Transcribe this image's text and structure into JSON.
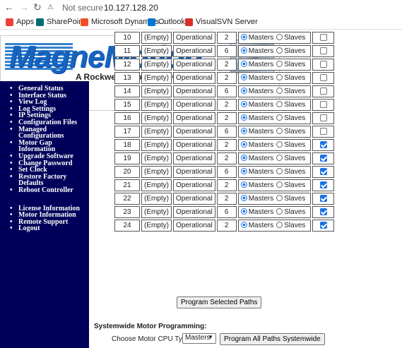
{
  "browser": {
    "security_label": "Not secure",
    "url": "10.127.128.20",
    "bookmarks": [
      {
        "label": "Apps",
        "icon": "apps-grid-icon",
        "color": "#ea4335"
      },
      {
        "label": "SharePoint",
        "icon": "sharepoint-icon",
        "color": "#036c70"
      },
      {
        "label": "Microsoft Dynamics...",
        "icon": "dynamics-icon",
        "color": "#f25022"
      },
      {
        "label": "Outlook",
        "icon": "outlook-icon",
        "color": "#0078d4"
      },
      {
        "label": "VisualSVN Server",
        "icon": "visualsvn-icon",
        "color": "#d93025"
      }
    ]
  },
  "banner": {
    "brand": "MagneMotion",
    "tagline": "A Rockwell Automation Company"
  },
  "sidebar": {
    "group1": [
      "General Status",
      "Interface Status",
      "View Log",
      "Log Settings",
      "IP Settings",
      "Configuration Files",
      "Managed Configurations",
      "Motor Gap Information",
      "Upgrade Software",
      "Change Password",
      "Set Clock",
      "Restore Factory Defaults",
      "Reboot Controller"
    ],
    "group2": [
      "License Information",
      "Motor Information",
      "Remote Support",
      "Logout"
    ]
  },
  "table": {
    "radio_labels": [
      "Masters",
      "Slaves"
    ],
    "rows": [
      {
        "idx": "10",
        "name": "(Empty)",
        "status": "Operational",
        "count": "2",
        "mode": "Masters",
        "checked": false
      },
      {
        "idx": "11",
        "name": "(Empty)",
        "status": "Operational",
        "count": "6",
        "mode": "Masters",
        "checked": false
      },
      {
        "idx": "12",
        "name": "(Empty)",
        "status": "Operational",
        "count": "2",
        "mode": "Masters",
        "checked": false
      },
      {
        "idx": "13",
        "name": "(Empty)",
        "status": "Operational",
        "count": "2",
        "mode": "Masters",
        "checked": false
      },
      {
        "idx": "14",
        "name": "(Empty)",
        "status": "Operational",
        "count": "6",
        "mode": "Masters",
        "checked": false
      },
      {
        "idx": "15",
        "name": "(Empty)",
        "status": "Operational",
        "count": "2",
        "mode": "Masters",
        "checked": false
      },
      {
        "idx": "16",
        "name": "(Empty)",
        "status": "Operational",
        "count": "2",
        "mode": "Masters",
        "checked": false
      },
      {
        "idx": "17",
        "name": "(Empty)",
        "status": "Operational",
        "count": "6",
        "mode": "Masters",
        "checked": false
      },
      {
        "idx": "18",
        "name": "(Empty)",
        "status": "Operational",
        "count": "2",
        "mode": "Masters",
        "checked": true
      },
      {
        "idx": "19",
        "name": "(Empty)",
        "status": "Operational",
        "count": "2",
        "mode": "Masters",
        "checked": true
      },
      {
        "idx": "20",
        "name": "(Empty)",
        "status": "Operational",
        "count": "6",
        "mode": "Masters",
        "checked": true
      },
      {
        "idx": "21",
        "name": "(Empty)",
        "status": "Operational",
        "count": "2",
        "mode": "Masters",
        "checked": true
      },
      {
        "idx": "22",
        "name": "(Empty)",
        "status": "Operational",
        "count": "2",
        "mode": "Masters",
        "checked": true
      },
      {
        "idx": "23",
        "name": "(Empty)",
        "status": "Operational",
        "count": "6",
        "mode": "Masters",
        "checked": true
      },
      {
        "idx": "24",
        "name": "(Empty)",
        "status": "Operational",
        "count": "2",
        "mode": "Masters",
        "checked": true
      }
    ]
  },
  "actions": {
    "program_selected": "Program Selected Paths",
    "systemwide_title": "Systemwide Motor Programming:",
    "cpu_label": "Choose Motor CPU Type:",
    "cpu_selected": "Masters",
    "program_all": "Program All Paths Systemwide"
  }
}
